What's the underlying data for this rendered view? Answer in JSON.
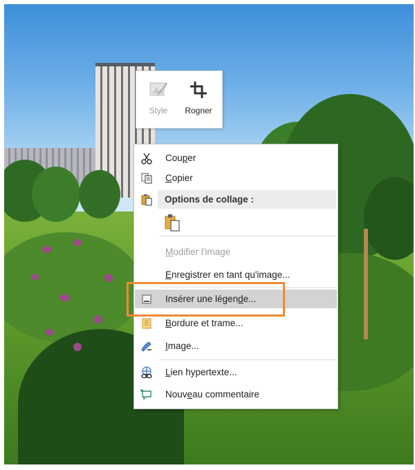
{
  "mini_toolbar": {
    "style_label": "Style",
    "crop_label": "Rogner"
  },
  "context_menu": {
    "items": [
      {
        "label_pre": "Cou",
        "label_key": "p",
        "label_post": "er",
        "icon": "scissors-icon",
        "enabled": true
      },
      {
        "label_pre": "",
        "label_key": "C",
        "label_post": "opier",
        "icon": "copy-icon",
        "enabled": true
      },
      {
        "section_title": "Options de collage :",
        "icon": "paste-icon"
      },
      {
        "paste_option_icon": "paste-keep-picture-icon"
      },
      {
        "label_pre": "",
        "label_key": "M",
        "label_post": "odifier l'image",
        "icon": "",
        "enabled": false
      },
      {
        "label_pre": "",
        "label_key": "E",
        "label_post": "nregistrer en tant qu'image...",
        "icon": "",
        "enabled": true
      },
      {
        "label_pre": "Insérer une légen",
        "label_key": "d",
        "label_post": "e...",
        "icon": "insert-caption-icon",
        "enabled": true,
        "highlighted": true
      },
      {
        "label_pre": "",
        "label_key": "B",
        "label_post": "ordure et trame...",
        "icon": "borders-icon",
        "enabled": true
      },
      {
        "label_pre": "",
        "label_key": "I",
        "label_post": "mage...",
        "icon": "format-picture-icon",
        "enabled": true
      },
      {
        "label_pre": "",
        "label_key": "L",
        "label_post": "ien hypertexte...",
        "icon": "hyperlink-icon",
        "enabled": true
      },
      {
        "label_pre": "Nouv",
        "label_key": "e",
        "label_post": "au commentaire",
        "icon": "new-comment-icon",
        "enabled": true
      }
    ]
  },
  "colors": {
    "highlight_box": "#ee8a35",
    "menu_highlight": "#d3d3d3"
  }
}
